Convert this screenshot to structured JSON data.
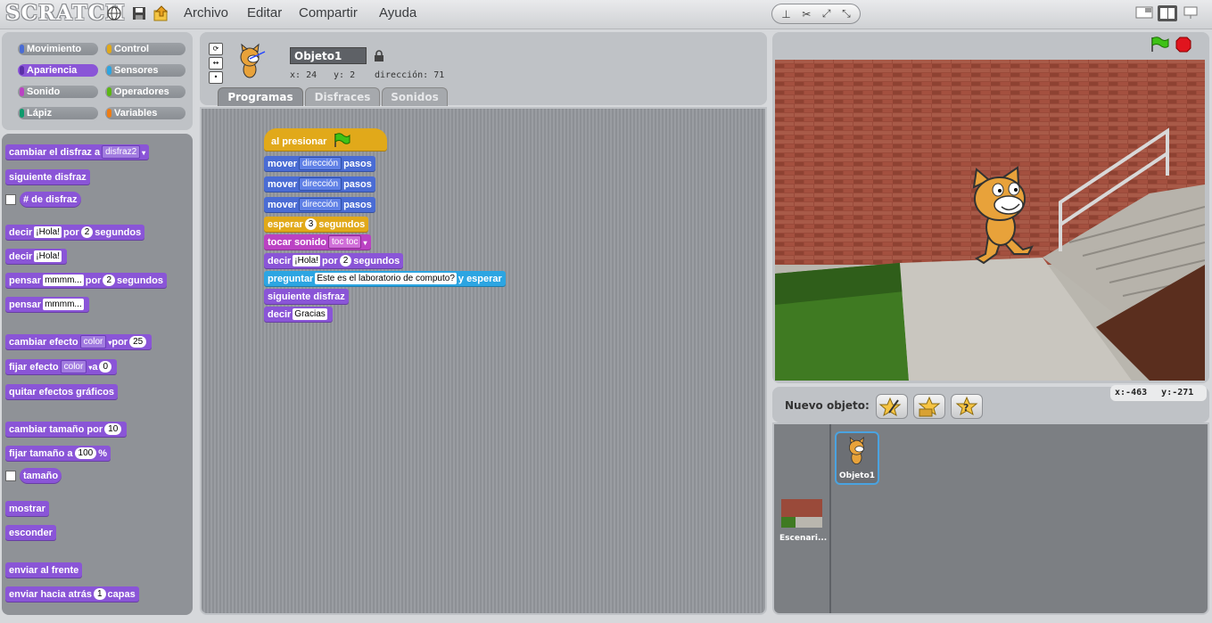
{
  "app": {
    "logo": "SCRATCH"
  },
  "menu": {
    "archivo": "Archivo",
    "editar": "Editar",
    "compartir": "Compartir",
    "ayuda": "Ayuda"
  },
  "categories": [
    {
      "label": "Movimiento",
      "color": "#4a6cd4"
    },
    {
      "label": "Control",
      "color": "#e1a91a"
    },
    {
      "label": "Apariencia",
      "color": "#8a55d7"
    },
    {
      "label": "Sensores",
      "color": "#2ca5e2"
    },
    {
      "label": "Sonido",
      "color": "#bb42c3"
    },
    {
      "label": "Operadores",
      "color": "#5cb712"
    },
    {
      "label": "Lápiz",
      "color": "#0e9a6c"
    },
    {
      "label": "Variables",
      "color": "#ee7d16"
    }
  ],
  "palette": {
    "b1": "cambiar el disfraz a",
    "b1_dd": "disfraz2",
    "b2": "siguiente disfraz",
    "b3": "# de disfraz",
    "b4a": "decir",
    "b4_in": "¡Hola!",
    "b4b": "por",
    "b4_num": "2",
    "b4c": "segundos",
    "b5a": "decir",
    "b5_in": "¡Hola!",
    "b6a": "pensar",
    "b6_in": "mmmm...",
    "b6b": "por",
    "b6_num": "2",
    "b6c": "segundos",
    "b7a": "pensar",
    "b7_in": "mmmm...",
    "b8a": "cambiar efecto",
    "b8_dd": "color",
    "b8b": "por",
    "b8_num": "25",
    "b9a": "fijar efecto",
    "b9_dd": "color",
    "b9b": "a",
    "b9_num": "0",
    "b10": "quitar efectos gráficos",
    "b11a": "cambiar tamaño por",
    "b11_num": "10",
    "b12a": "fijar tamaño a",
    "b12_num": "100",
    "b12b": "%",
    "b13": "tamaño",
    "b14": "mostrar",
    "b15": "esconder",
    "b16": "enviar al frente",
    "b17a": "enviar hacia atrás",
    "b17_num": "1",
    "b17b": "capas"
  },
  "sprite": {
    "name": "Objeto1",
    "x_label": "x:",
    "x": "24",
    "y_label": "y:",
    "y": "2",
    "dir_label": "dirección:",
    "dir": "71"
  },
  "tabs": {
    "programas": "Programas",
    "disfraces": "Disfraces",
    "sonidos": "Sonidos"
  },
  "script": {
    "hat": "al presionar",
    "m1a": "mover",
    "m1b": "dirección",
    "m1c": "pasos",
    "m2a": "mover",
    "m2b": "dirección",
    "m2c": "pasos",
    "m3a": "mover",
    "m3b": "dirección",
    "m3c": "pasos",
    "waita": "esperar",
    "wait_num": "3",
    "waitb": "segundos",
    "snda": "tocar sonido",
    "snd_dd": "toc toc",
    "saya": "decir",
    "say_in": "¡Hola!",
    "sayb": "por",
    "say_num": "2",
    "sayc": "segundos",
    "aska": "preguntar",
    "ask_in": "Este es el laboratorio de computo?",
    "askb": "y esperar",
    "next": "siguiente disfraz",
    "say2a": "decir",
    "say2_in": "Gracias"
  },
  "stage": {
    "mouse_x_label": "x:",
    "mouse_x": "-463",
    "mouse_y_label": "y:",
    "mouse_y": "-271"
  },
  "sprite_list": {
    "new_label": "Nuevo objeto:",
    "sprite1": "Objeto1",
    "stage_label": "Escenari..."
  }
}
